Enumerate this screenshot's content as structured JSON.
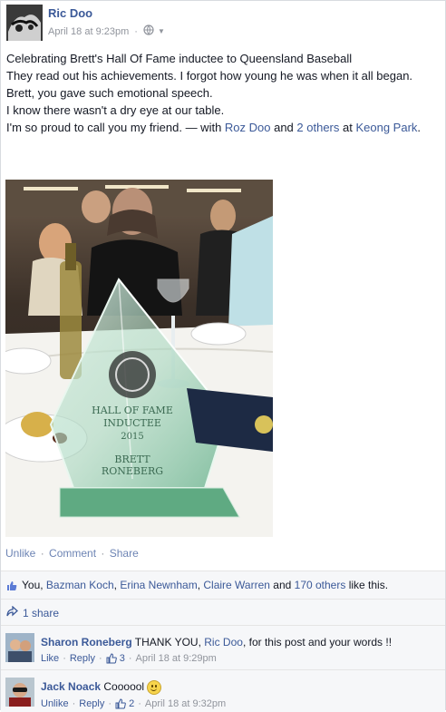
{
  "post": {
    "author": "Ric Doo",
    "timestamp": "April 18 at 9:23pm",
    "separator": "·",
    "body": [
      "Celebrating Brett's Hall Of Fame inductee to Queensland Baseball",
      "They read out his achievements. I forgot how young he was when it all began.",
      "Brett, you gave such emotional speech.",
      "I know there wasn't a dry eye at our table."
    ],
    "last_line_prefix": "I'm so proud to call you my friend. — with ",
    "tag_name": "Roz Doo",
    "tag_and": " and ",
    "tag_others": "2 others",
    "tag_at": " at ",
    "tag_place": "Keong Park",
    "tag_end": ".",
    "photo_text": {
      "line1": "HALL OF FAME",
      "line2": "INDUCTEE",
      "line3": "2015",
      "line4": "BRETT",
      "line5": "RONEBERG"
    }
  },
  "actions": {
    "unlike": "Unlike",
    "comment": "Comment",
    "share": "Share",
    "dot": "·"
  },
  "likes": {
    "you": "You, ",
    "name1": "Bazman Koch",
    "comma1": ", ",
    "name2": "Erina Newnham",
    "comma2": ", ",
    "name3": "Claire Warren",
    "and": " and ",
    "others": "170 others",
    "suffix": " like this."
  },
  "shares": {
    "label": "1 share"
  },
  "comments": [
    {
      "name": "Sharon Roneberg",
      "text_before": " THANK YOU, ",
      "mention": "Ric Doo",
      "text_after": ", for this post and your words !!",
      "action": "Like",
      "reply": "Reply",
      "like_count": "3",
      "time": "April 18 at 9:29pm"
    },
    {
      "name": "Jack Noack",
      "text_before": " Coooool ",
      "action": "Unlike",
      "reply": "Reply",
      "like_count": "2",
      "time": "April 18 at 9:32pm"
    }
  ],
  "colors": {
    "link": "#3b5998",
    "meta": "#90949c",
    "panel": "#f6f7f9"
  }
}
